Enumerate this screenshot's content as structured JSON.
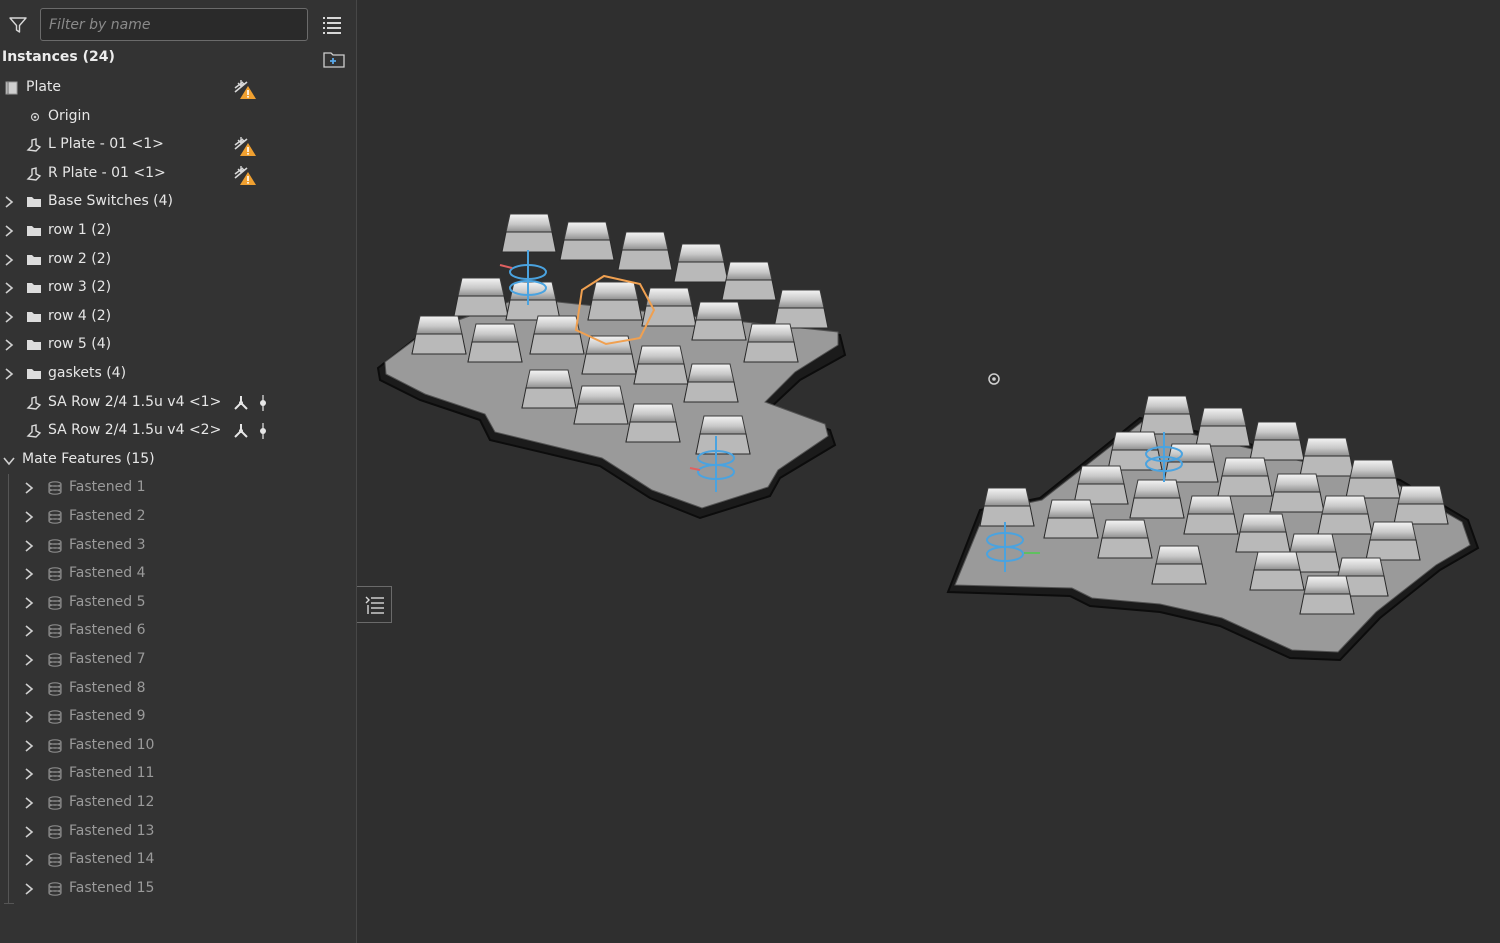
{
  "filter": {
    "placeholder": "Filter by name",
    "value": ""
  },
  "instances": {
    "header": "Instances (24)",
    "items": [
      {
        "label": "Plate",
        "kind": "part-studio",
        "warning": true
      },
      {
        "label": "Origin",
        "kind": "origin"
      },
      {
        "label": "L Plate - 01 <1>",
        "kind": "part",
        "warning": true
      },
      {
        "label": "R Plate - 01 <1>",
        "kind": "part",
        "warning": true
      },
      {
        "label": "Base Switches (4)",
        "kind": "folder"
      },
      {
        "label": "row 1 (2)",
        "kind": "folder"
      },
      {
        "label": "row 2 (2)",
        "kind": "folder"
      },
      {
        "label": "row 3 (2)",
        "kind": "folder"
      },
      {
        "label": "row 4 (2)",
        "kind": "folder"
      },
      {
        "label": "row 5 (4)",
        "kind": "folder"
      },
      {
        "label": "gaskets (4)",
        "kind": "folder"
      },
      {
        "label": "SA Row 2/4 1.5u v4 <1>",
        "kind": "part",
        "actions": true
      },
      {
        "label": "SA Row 2/4 1.5u v4 <2>",
        "kind": "part",
        "actions": true
      }
    ]
  },
  "mates": {
    "header": "Mate Features (15)",
    "items": [
      "Fastened 1",
      "Fastened 2",
      "Fastened 3",
      "Fastened 4",
      "Fastened 5",
      "Fastened 6",
      "Fastened 7",
      "Fastened 8",
      "Fastened 9",
      "Fastened 10",
      "Fastened 11",
      "Fastened 12",
      "Fastened 13",
      "Fastened 14",
      "Fastened 15"
    ]
  },
  "colors": {
    "panel_bg": "#333333",
    "viewport_bg": "#2f2f2f",
    "warning": "#f0a030",
    "accent_blue": "#4aa3e0",
    "selection_orange": "#f0a050"
  }
}
